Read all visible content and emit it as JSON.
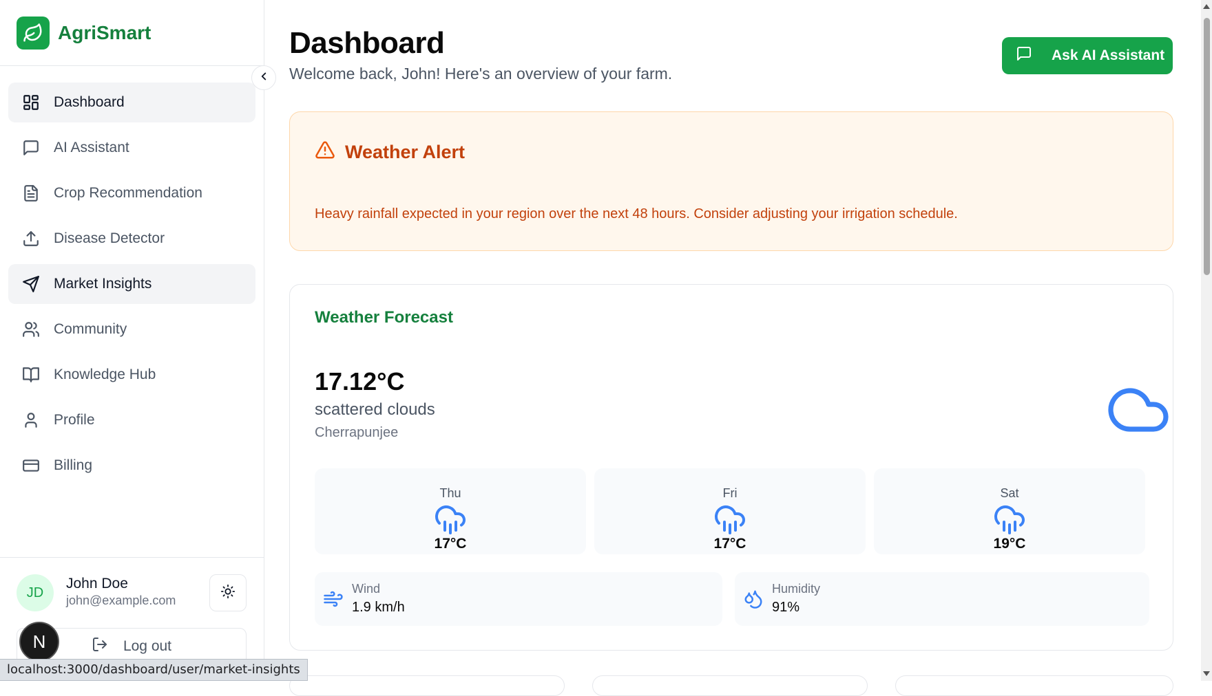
{
  "app": {
    "name": "AgriSmart"
  },
  "sidebar": {
    "items": [
      {
        "label": "Dashboard",
        "icon": "layout-grid-icon",
        "active": true
      },
      {
        "label": "AI Assistant",
        "icon": "message-square-icon",
        "active": false
      },
      {
        "label": "Crop Recommendation",
        "icon": "file-text-icon",
        "active": false
      },
      {
        "label": "Disease Detector",
        "icon": "upload-icon",
        "active": false
      },
      {
        "label": "Market Insights",
        "icon": "send-icon",
        "active": false,
        "hovered": true
      },
      {
        "label": "Community",
        "icon": "users-icon",
        "active": false
      },
      {
        "label": "Knowledge Hub",
        "icon": "book-open-icon",
        "active": false
      },
      {
        "label": "Profile",
        "icon": "user-icon",
        "active": false
      },
      {
        "label": "Billing",
        "icon": "credit-card-icon",
        "active": false
      }
    ]
  },
  "user": {
    "initials": "JD",
    "name": "John Doe",
    "email": "john@example.com",
    "logout_label": "Log out"
  },
  "overlay": {
    "next_badge": "N",
    "status_url": "localhost:3000/dashboard/user/market-insights"
  },
  "header": {
    "title": "Dashboard",
    "subtitle": "Welcome back, John! Here's an overview of your farm.",
    "ask_button": "Ask AI Assistant"
  },
  "alert": {
    "title": "Weather Alert",
    "message": "Heavy rainfall expected in your region over the next 48 hours. Consider adjusting your irrigation schedule."
  },
  "forecast": {
    "title": "Weather Forecast",
    "temperature": "17.12°C",
    "description": "scattered clouds",
    "location": "Cherrapunjee",
    "days": [
      {
        "day": "Thu",
        "temp": "17°C",
        "icon": "cloud-rain-icon"
      },
      {
        "day": "Fri",
        "temp": "17°C",
        "icon": "cloud-rain-icon"
      },
      {
        "day": "Sat",
        "temp": "19°C",
        "icon": "cloud-rain-icon"
      }
    ],
    "wind": {
      "label": "Wind",
      "value": "1.9 km/h"
    },
    "humidity": {
      "label": "Humidity",
      "value": "91%"
    }
  },
  "colors": {
    "brand": "#16a34a",
    "brand_text": "#15803d",
    "alert_bg": "#fff7ed",
    "alert_text": "#c2410c",
    "weather_icon": "#3b82f6"
  }
}
